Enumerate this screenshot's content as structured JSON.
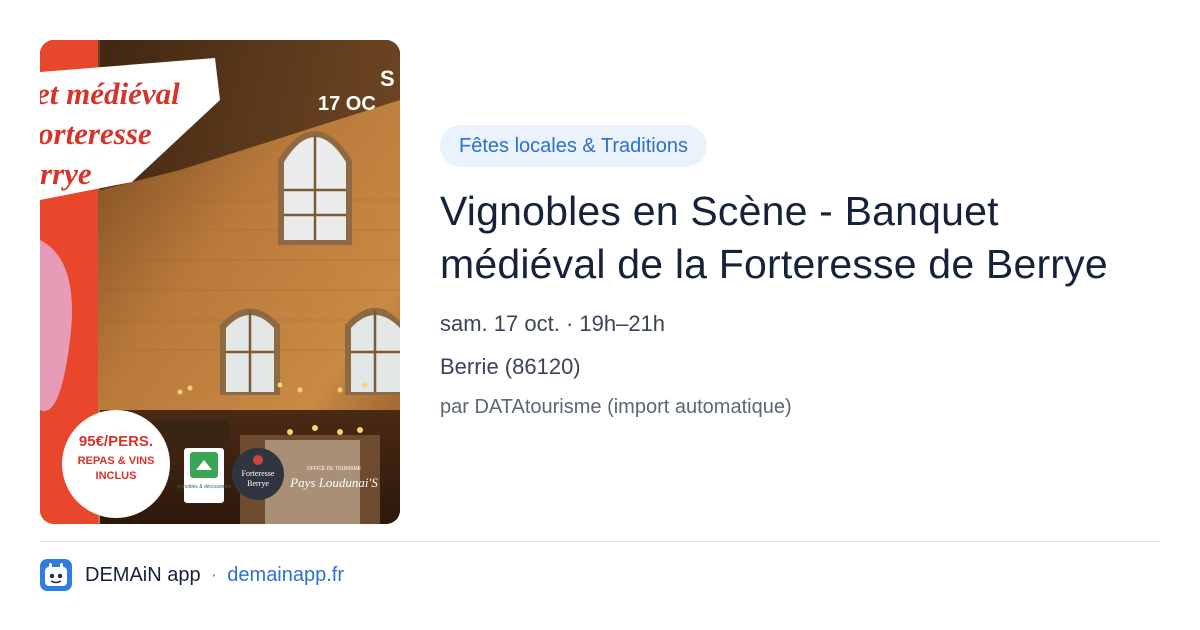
{
  "poster": {
    "title_lines": [
      "et médiéval",
      "orteresse",
      "rrye"
    ],
    "corner_date_top": "S",
    "corner_date": "17 OC",
    "price": "95€/PERS.",
    "price_detail_1": "REPAS & VINS",
    "price_detail_2": "INCLUS",
    "badge_text": "vignobles & découvertes",
    "logo_forteresse_1": "Forteresse",
    "logo_forteresse_2": "Berrye",
    "logo_office": "OFFICE DE TOURISME",
    "logo_pays": "Pays Loudunai'S"
  },
  "event": {
    "category": "Fêtes locales & Traditions",
    "title": "Vignobles en Scène - Banquet médiéval de la Forteresse de Berrye",
    "date": "sam. 17 oct. · 19h–21h",
    "place": "Berrie (86120)",
    "source": "par DATAtourisme (import automatique)"
  },
  "footer": {
    "app_name": "DEMAiN app",
    "separator": "·",
    "domain": "demainapp.fr"
  },
  "colors": {
    "accent": "#2f6fcf",
    "pill_bg": "#eaf2fc",
    "poster_red": "#e8472b"
  }
}
